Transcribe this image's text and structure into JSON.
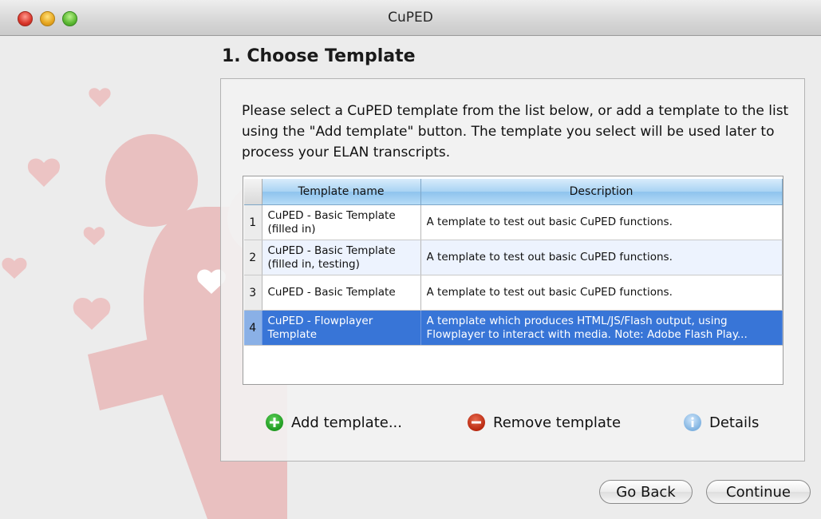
{
  "window": {
    "title": "CuPED"
  },
  "step": {
    "heading": "1. Choose Template"
  },
  "instructions": "Please select a CuPED template from the list below, or add a template to the list using the \"Add template\" button.  The template you select will be used later to process your ELAN transcripts.",
  "table": {
    "columns": [
      "Template name",
      "Description"
    ],
    "rows": [
      {
        "num": "1",
        "name": "CuPED - Basic Template (filled in)",
        "description": "A template to test out basic CuPED functions."
      },
      {
        "num": "2",
        "name": "CuPED - Basic Template (filled in, testing)",
        "description": "A template to test out basic CuPED functions."
      },
      {
        "num": "3",
        "name": "CuPED - Basic Template",
        "description": "A template to test out basic CuPED functions."
      },
      {
        "num": "4",
        "name": "CuPED - Flowplayer Template",
        "description": "A template which produces HTML/JS/Flash output, using Flowplayer to interact with media.  Note: Adobe Flash Play...",
        "selected": true
      }
    ]
  },
  "actions": {
    "add": "Add template...",
    "remove": "Remove template",
    "details": "Details"
  },
  "nav": {
    "back": "Go Back",
    "continue": "Continue"
  }
}
